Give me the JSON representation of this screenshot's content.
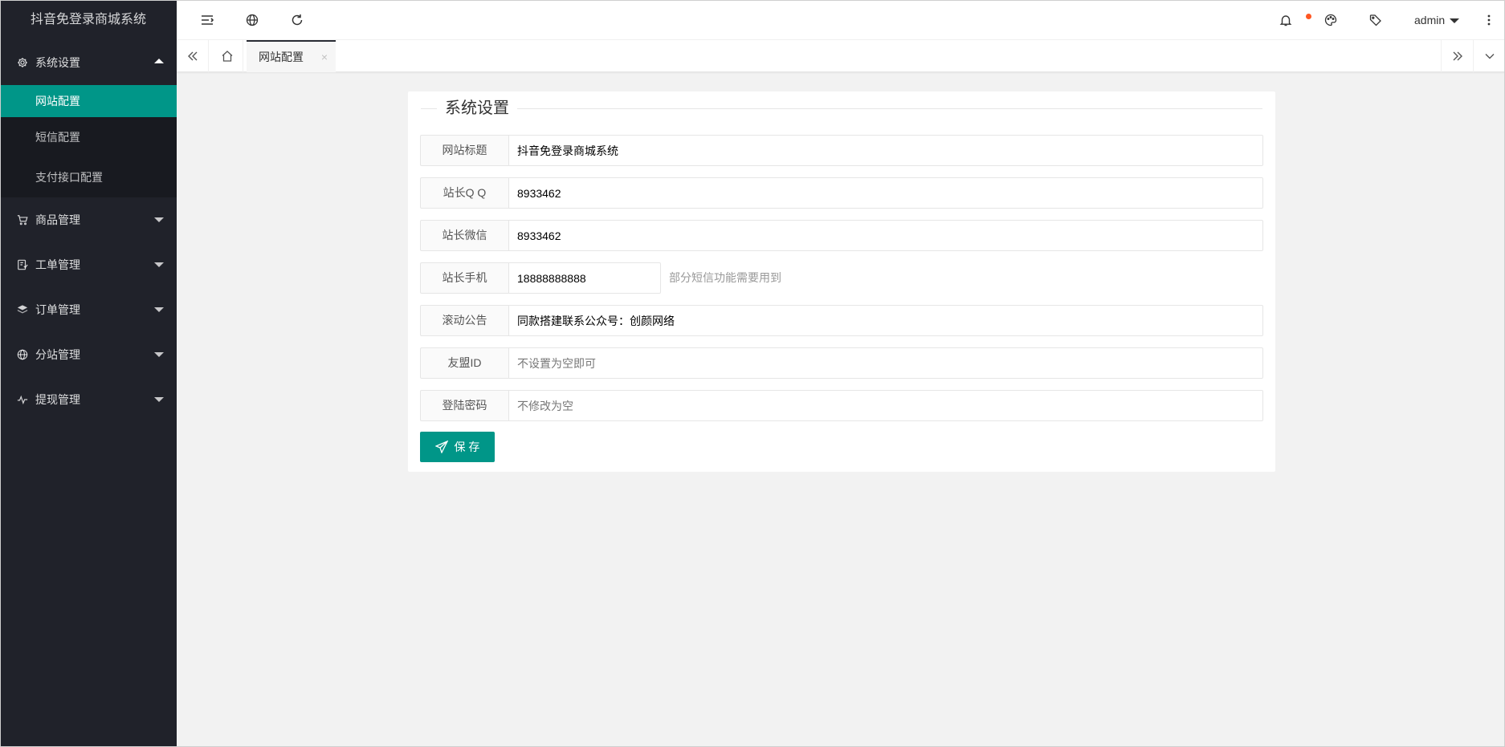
{
  "app_title": "抖音免登录商城系统",
  "sidebar": {
    "groups": [
      {
        "label": "系统设置",
        "icon": "gear-icon",
        "expanded": true,
        "items": [
          {
            "label": "网站配置",
            "active": true
          },
          {
            "label": "短信配置"
          },
          {
            "label": "支付接口配置"
          }
        ]
      },
      {
        "label": "商品管理",
        "icon": "cart-icon"
      },
      {
        "label": "工单管理",
        "icon": "ticket-icon"
      },
      {
        "label": "订单管理",
        "icon": "layers-icon"
      },
      {
        "label": "分站管理",
        "icon": "globe-icon"
      },
      {
        "label": "提现管理",
        "icon": "pulse-icon"
      }
    ]
  },
  "header": {
    "icons": [
      "menu-toggle-icon",
      "globe-icon",
      "refresh-icon",
      "bell-icon",
      "palette-icon",
      "tag-icon",
      "more-vertical-icon"
    ],
    "notification_dot_color": "#ff5722",
    "user": "admin"
  },
  "tabs": {
    "active": {
      "label": "网站配置",
      "close": "×"
    }
  },
  "form": {
    "legend": "系统设置",
    "fields": [
      {
        "label": "网站标题",
        "value": "抖音免登录商城系统",
        "placeholder": ""
      },
      {
        "label": "站长Q Q",
        "value": "8933462",
        "placeholder": ""
      },
      {
        "label": "站长微信",
        "value": "8933462",
        "placeholder": ""
      },
      {
        "label": "站长手机",
        "value": "18888888888",
        "placeholder": "",
        "aux": "部分短信功能需要用到"
      },
      {
        "label": "滚动公告",
        "value": "同款搭建联系公众号：创颜网络",
        "placeholder": ""
      },
      {
        "label": "友盟ID",
        "value": "",
        "placeholder": "不设置为空即可"
      },
      {
        "label": "登陆密码",
        "value": "",
        "placeholder": "不修改为空"
      }
    ],
    "save_label": "保 存"
  },
  "colors": {
    "sidebar_bg": "#20222a",
    "accent": "#009688",
    "page_bg": "#f2f2f2"
  }
}
